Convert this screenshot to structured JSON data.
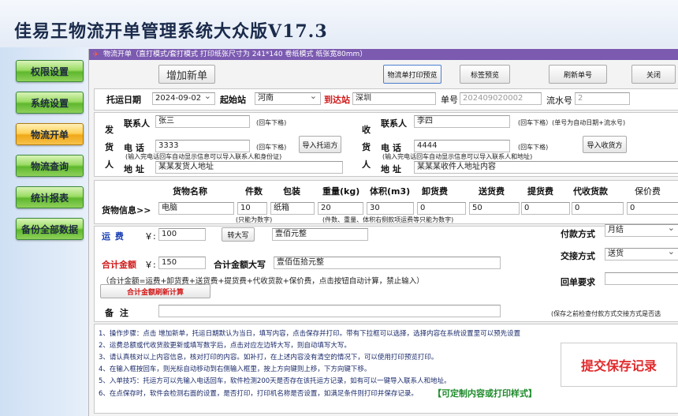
{
  "app_title": "佳易王物流开单管理系统大众版V17.3",
  "nav": [
    "权限设置",
    "系统设置",
    "物流开单",
    "物流查询",
    "统计报表",
    "备份全部数据"
  ],
  "panel_title": "物流开单（直打模式/套打模式 打印纸张尺寸为 241*140 卷纸模式 纸张宽80mm）",
  "toolbar": {
    "add": "增加新单",
    "print_preview": "物流单打印预览",
    "label_preview": "标签预览",
    "refresh": "刷新单号",
    "close": "关闭"
  },
  "header": {
    "date_label": "托运日期",
    "date": "2024-09-02",
    "from_label": "起始站",
    "from": "河南",
    "to_label": "到达站",
    "to": "深圳",
    "order_label": "单号",
    "order": "202409020002",
    "serial_label": "流水号",
    "serial": "2"
  },
  "sender": {
    "side1": "发",
    "side2": "货",
    "side3": "人",
    "contact_label": "联系人",
    "contact": "张三",
    "phone_label": "电  话",
    "phone": "3333",
    "addr_label": "地  址",
    "addr": "某某发货人地址",
    "hint1": "(回车下格)",
    "hint2": "(回车下格)",
    "hint3": "(输入完电话回车自动显示信息可以导入联系人和身份证)",
    "import_btn": "导入托运方"
  },
  "receiver": {
    "side1": "收",
    "side2": "货",
    "side3": "人",
    "contact_label": "联系人",
    "contact": "李四",
    "phone_label": "电  话",
    "phone": "4444",
    "addr_label": "地  址",
    "addr": "某某某收件人地址内容",
    "hint1": "(回车下格）(单号为自动日期+流水号)",
    "hint2": "(回车下格)",
    "hint3": "(输入完电话回车自动显示信息可以导入联系人和地址)",
    "import_btn": "导入收货方"
  },
  "goods": {
    "row_label": "货物信息>>",
    "headers": [
      "货物名称",
      "件数",
      "包装",
      "重量(kg)",
      "体积(m3)",
      "卸货费",
      "送货费",
      "提货费",
      "代收货款",
      "保价费"
    ],
    "values": [
      "电脑",
      "10",
      "纸箱",
      "20",
      "30",
      "0",
      "50",
      "0",
      "0",
      "0"
    ],
    "note1": "(只能为数字)",
    "note2": "(件数、重量、体积右侧款项运费等只能为数字)"
  },
  "fee": {
    "freight_label": "运    费",
    "yen": "￥:",
    "freight": "100",
    "convert_btn": "转大写",
    "freight_upper": "壹佰元整",
    "total_label": "合计金额",
    "total": "150",
    "total_upper_label": "合计金额大写",
    "total_upper": "壹佰伍拾元整",
    "formula": "（合计金额=运费+卸货费+送货费+提货费+代收货款+保价费，点击按钮自动计算，禁止输入）",
    "refresh_btn": "合计金额刷新计算",
    "remark_label": "备    注"
  },
  "payment": {
    "pay_label": "付款方式",
    "pay": "月结",
    "deliver_label": "交接方式",
    "deliver": "送货",
    "receipt_label": "回单要求",
    "save_note": "(保存之前检查付款方式交接方式是否选"
  },
  "instructions": [
    "1、操作步骤：点击 增加新单，托运日期默认为当日，填写内容，点击保存并打印。带有下拉框可以选择，选择内容在系统设置里可以预先设置",
    "2、运费总额或代收货款更新或填写数字后，点击对应左边转大写，则自动填写大写。",
    "3、请认真核对以上内容信息，核对打印的内容。如补打，在上述内容没有清空的情况下，可以使用打印预览打印。",
    "4、在输入框按回车，则光标自动移动到右侧输入框里，按上方向键则上移，下方向键下移。",
    "5、入单技巧：托运方可以先输入电话回车，软件检测200天是否存在该托运方记录，如有可以一键导入联系人和地址。",
    "6、在点保存时，软件会检测右面的设置，是否打印，打印机名称是否设置，如满足条件则打印并保存记录。"
  ],
  "custom_link": "【可定制内容或打印样式】",
  "submit": "提交保存记录"
}
